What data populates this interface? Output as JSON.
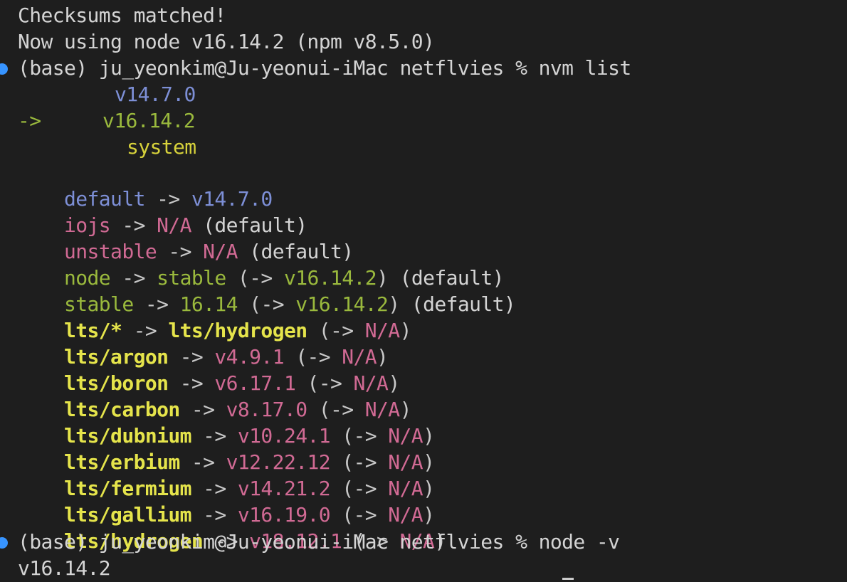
{
  "colors": {
    "background": "#1e1e1e",
    "text": "#d4d4d4",
    "blue": "#7d8fd6",
    "green": "#9ab93d",
    "yellow": "#d7d23b",
    "pink": "#d16a94",
    "prompt_dot": "#3794ff"
  },
  "lines": {
    "l1": "Checksums matched!",
    "l2": "Now using node v16.14.2 (npm v8.5.0)",
    "prompt1": "(base) ju_yeonkim@Ju-yeonui-iMac netflvies % nvm list",
    "v_a": "v14.7.0",
    "arrow": "->",
    "v_b": "v16.14.2",
    "system": "system",
    "default_key": "default",
    "default_val": "v14.7.0",
    "iojs": "iojs",
    "na": "N/A",
    "default_paren": "(default)",
    "unstable": "unstable",
    "node": "node",
    "stable": "stable",
    "stable_ver": "16.14",
    "paren_open_arrow": "(->",
    "paren_close": ")",
    "v16142": "v16.14.2",
    "lts_star": "lts/*",
    "lts_hydrogen_name": "lts/hydrogen",
    "lts_rows": [
      {
        "name": "lts/argon",
        "ver": "v4.9.1"
      },
      {
        "name": "lts/boron",
        "ver": "v6.17.1"
      },
      {
        "name": "lts/carbon",
        "ver": "v8.17.0"
      },
      {
        "name": "lts/dubnium",
        "ver": "v10.24.1"
      },
      {
        "name": "lts/erbium",
        "ver": "v12.22.12"
      },
      {
        "name": "lts/fermium",
        "ver": "v14.21.2"
      },
      {
        "name": "lts/gallium",
        "ver": "v16.19.0"
      },
      {
        "name": "lts/hydrogen",
        "ver": "v18.12.1"
      }
    ],
    "prompt2": "(base) ju_yeonkim@Ju-yeonui-iMac netflvies % node -v",
    "node_version_output": "v16.14.2"
  }
}
